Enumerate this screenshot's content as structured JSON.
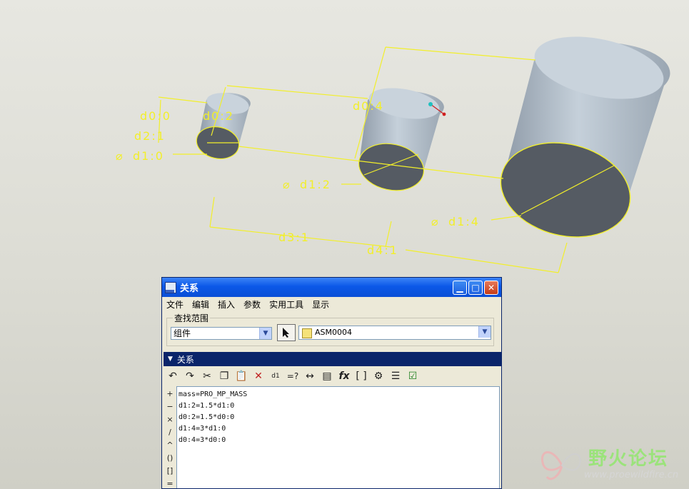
{
  "viewport": {
    "dimensions": [
      "d0:0",
      "d0:2",
      "d2:1",
      "d1:0",
      "d0:4",
      "d1:2",
      "d1:4",
      "d3:1",
      "d4:1"
    ],
    "diameter_symbol": "⌀"
  },
  "dialog": {
    "title": "关系",
    "menu": [
      "文件",
      "编辑",
      "插入",
      "参数",
      "实用工具",
      "显示"
    ],
    "search_scope": {
      "legend": "查找范围",
      "scope_value": "组件",
      "model_value": "ASM0004"
    },
    "section_label": "关系",
    "toolbar": [
      "undo-icon",
      "redo-icon",
      "cut-icon",
      "copy-icon",
      "paste-icon",
      "delete-icon",
      "evaluate-icon",
      "verify-icon",
      "dimension-icon",
      "parameter-icon",
      "function-icon",
      "bracket-icon",
      "sort-icon",
      "info-icon",
      "checkmark-icon"
    ],
    "operators": [
      "+",
      "−",
      "×",
      "/",
      "^",
      "()",
      "[]",
      "="
    ],
    "relations": [
      "mass=PRO_MP_MASS",
      "d1:2=1.5*d1:0",
      "d0:2=1.5*d0:0",
      "d1:4=3*d1:0",
      "d0:4=3*d0:0"
    ]
  },
  "watermark": {
    "title": "野火论坛",
    "url": "www.proewildfire.cn"
  }
}
